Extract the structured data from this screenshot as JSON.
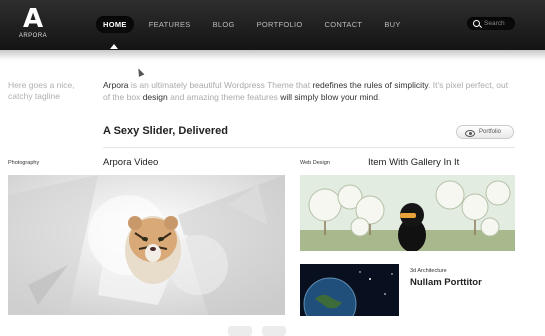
{
  "header": {
    "logo_mark": "A",
    "logo_text": "ARPORA",
    "nav": [
      "HOME",
      "FEATURES",
      "BLOG",
      "PORTFOLIO",
      "CONTACT",
      "BUY"
    ],
    "active_nav": "HOME",
    "search_placeholder": "Search"
  },
  "intro": {
    "tagline": "Here goes a nice, catchy tagline",
    "text_parts": [
      {
        "t": "Arpora",
        "dark": true
      },
      {
        "t": " is an ultimately beautiful Wordpress Theme that ",
        "dark": false
      },
      {
        "t": "redefines the rules of simplicity",
        "dark": true
      },
      {
        "t": ". It's pixel perfect, out of the box ",
        "dark": false
      },
      {
        "t": "design",
        "dark": true
      },
      {
        "t": " and amazing theme features ",
        "dark": false
      },
      {
        "t": "will simply blow your mind",
        "dark": true
      },
      {
        "t": ".",
        "dark": false
      }
    ]
  },
  "slider": {
    "title": "A Sexy Slider, Delivered",
    "button_label": "Portfolio"
  },
  "items": [
    {
      "category": "Photography",
      "title": "Arpora Video"
    },
    {
      "category": "Web Design",
      "title": "Item With Gallery In It"
    },
    {
      "category": "3d Architecture",
      "title": "Nullam Porttitor"
    }
  ],
  "colors": {
    "header_bg": "#1e1e1e",
    "active_nav_bg": "#0a0a0a",
    "text_dark": "#222222",
    "text_muted": "#aaaaaa"
  }
}
